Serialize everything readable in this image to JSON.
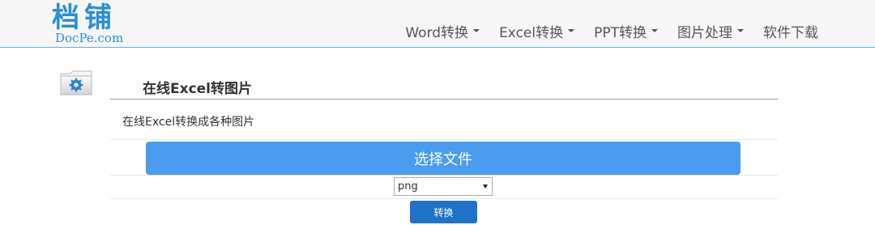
{
  "header": {
    "logo_cn": "档铺",
    "logo_en": "DocPe.com",
    "nav": [
      {
        "label": "Word转换",
        "dropdown": true
      },
      {
        "label": "Excel转换",
        "dropdown": true
      },
      {
        "label": "PPT转换",
        "dropdown": true
      },
      {
        "label": "图片处理",
        "dropdown": true
      },
      {
        "label": "软件下载",
        "dropdown": false
      }
    ]
  },
  "section": {
    "icon": "gear-folder-icon",
    "title": "在线Excel转图片",
    "description": "在线Excel转换成各种图片"
  },
  "form": {
    "choose_file_label": "选择文件",
    "format_value": "png",
    "convert_label": "转换"
  },
  "colors": {
    "accent": "#4a9cef",
    "brand": "#2a8fd6",
    "convert": "#1e73c8"
  }
}
